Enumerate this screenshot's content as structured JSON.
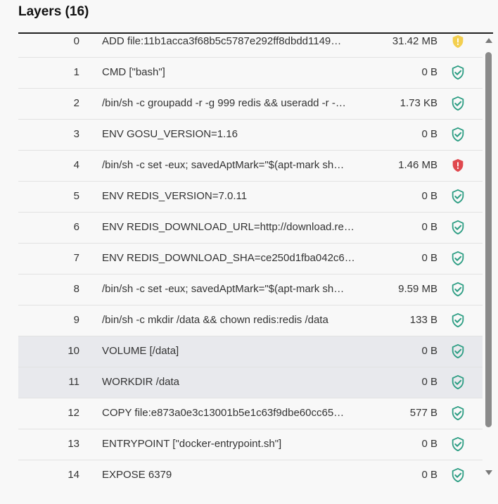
{
  "title": "Layers (16)",
  "layers": [
    {
      "index": "0",
      "command": "ADD file:11b1acca3f68b5c5787e292ff8dbdd1149…",
      "size": "31.42 MB",
      "status": "warning"
    },
    {
      "index": "1",
      "command": "CMD [\"bash\"]",
      "size": "0 B",
      "status": "ok"
    },
    {
      "index": "2",
      "command": "/bin/sh -c groupadd -r -g 999 redis && useradd -r -…",
      "size": "1.73 KB",
      "status": "ok"
    },
    {
      "index": "3",
      "command": "ENV GOSU_VERSION=1.16",
      "size": "0 B",
      "status": "ok"
    },
    {
      "index": "4",
      "command": "/bin/sh -c set -eux; savedAptMark=\"$(apt-mark sh…",
      "size": "1.46 MB",
      "status": "error"
    },
    {
      "index": "5",
      "command": "ENV REDIS_VERSION=7.0.11",
      "size": "0 B",
      "status": "ok"
    },
    {
      "index": "6",
      "command": "ENV REDIS_DOWNLOAD_URL=http://download.re…",
      "size": "0 B",
      "status": "ok"
    },
    {
      "index": "7",
      "command": "ENV REDIS_DOWNLOAD_SHA=ce250d1fba042c6…",
      "size": "0 B",
      "status": "ok"
    },
    {
      "index": "8",
      "command": "/bin/sh -c set -eux; savedAptMark=\"$(apt-mark sh…",
      "size": "9.59 MB",
      "status": "ok"
    },
    {
      "index": "9",
      "command": "/bin/sh -c mkdir /data && chown redis:redis /data",
      "size": "133 B",
      "status": "ok"
    },
    {
      "index": "10",
      "command": "VOLUME [/data]",
      "size": "0 B",
      "status": "ok",
      "selected": true
    },
    {
      "index": "11",
      "command": "WORKDIR /data",
      "size": "0 B",
      "status": "ok",
      "selected": true
    },
    {
      "index": "12",
      "command": "COPY file:e873a0e3c13001b5e1c63f9dbe60cc65…",
      "size": "577 B",
      "status": "ok"
    },
    {
      "index": "13",
      "command": "ENTRYPOINT [\"docker-entrypoint.sh\"]",
      "size": "0 B",
      "status": "ok"
    },
    {
      "index": "14",
      "command": "EXPOSE 6379",
      "size": "0 B",
      "status": "ok"
    }
  ],
  "colors": {
    "ok": "#2e9e84",
    "warning": "#f3cf4f",
    "error": "#e0484e",
    "selected_row": "#e8e9ed"
  },
  "icons": {
    "ok": "shield-check-icon",
    "warning": "shield-warning-icon",
    "error": "shield-error-icon"
  }
}
